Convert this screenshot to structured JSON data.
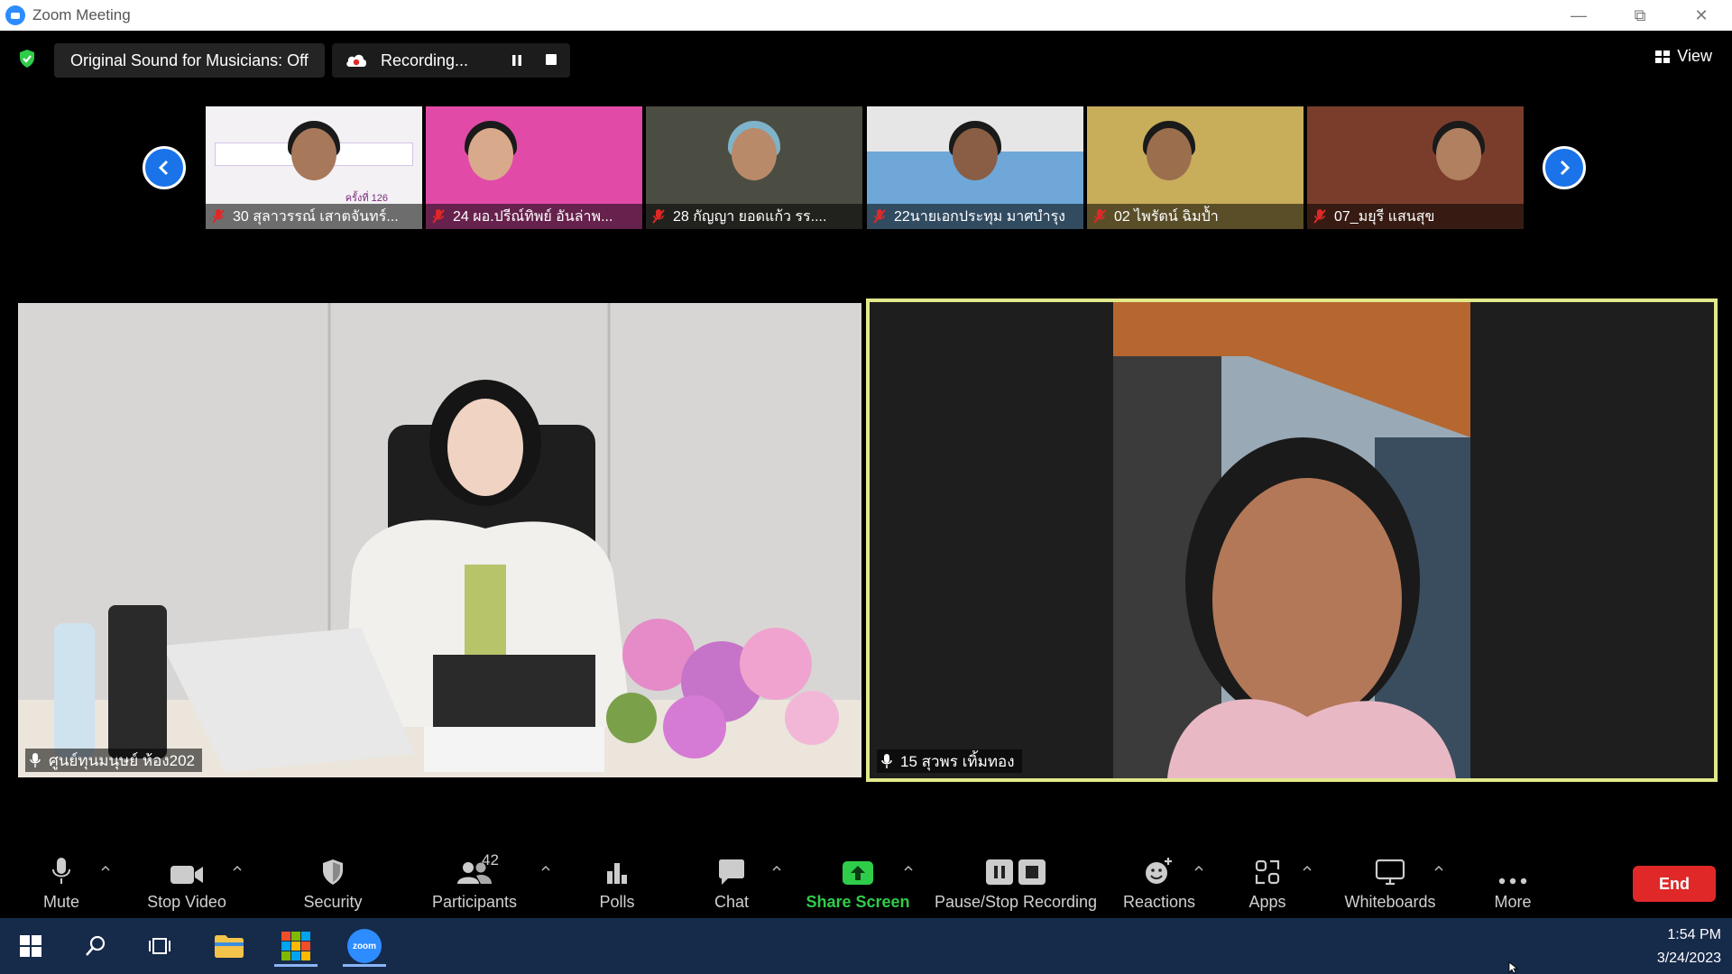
{
  "window": {
    "title": "Zoom Meeting"
  },
  "topbar": {
    "original_sound": "Original Sound for Musicians: Off",
    "recording_label": "Recording...",
    "view_label": "View"
  },
  "thumbnails": [
    {
      "name": "30 สุลาวรรณ์ เสาตจันทร์...",
      "bg": "#f3f1f4"
    },
    {
      "name": "24 ผอ.ปรีณ์ทิพย์ อันล่าพ...",
      "bg": "#e24aa8"
    },
    {
      "name": "28 กัญญา  ยอดแก้ว รร....",
      "bg": "#4b4d42"
    },
    {
      "name": "22นายเอกประทุม มาศบำรุง",
      "bg": "#6ea7d8"
    },
    {
      "name": "02 ไพรัตน์  ฉิมป้ำ",
      "bg": "#c8ad5a"
    },
    {
      "name": "07_มยุรี แสนสุข",
      "bg": "#7a3d2c"
    }
  ],
  "thumb_slide_text": "ครั้งที่ 126",
  "main_tiles": {
    "left_name": "ศูนย์ทุนมนุษย์ ห้อง202",
    "right_name": "15 สุวพร เทิ้มทอง"
  },
  "toolbar": {
    "mute": "Mute",
    "stop_video": "Stop Video",
    "security": "Security",
    "participants": "Participants",
    "participants_count": "42",
    "polls": "Polls",
    "chat": "Chat",
    "share_screen": "Share Screen",
    "pause_stop_recording": "Pause/Stop Recording",
    "reactions": "Reactions",
    "apps": "Apps",
    "whiteboards": "Whiteboards",
    "more": "More",
    "end": "End"
  },
  "taskbar": {
    "time": "1:54 PM",
    "date": "3/24/2023",
    "zoom_label": "zoom"
  },
  "colors": {
    "accent_blue": "#1a73e8",
    "share_green": "#2fcc4a",
    "end_red": "#e02828",
    "active_speaker": "#e3e98a",
    "taskbar": "#162a4a"
  }
}
